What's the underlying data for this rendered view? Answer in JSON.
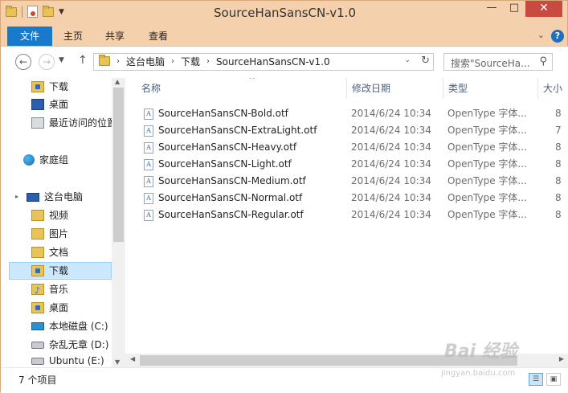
{
  "window": {
    "title": "SourceHanSansCN-v1.0",
    "minimize": "—",
    "maximize": "□",
    "close": "✕"
  },
  "ribbon": {
    "tabs": [
      "文件",
      "主页",
      "共享",
      "查看"
    ],
    "collapse": "⌄",
    "help": "?"
  },
  "nav_bar": {
    "back": "←",
    "forward": "→",
    "up": "↑",
    "breadcrumbs": [
      "这台电脑",
      "下载",
      "SourceHanSansCN-v1.0"
    ],
    "breadcrumb_sep": "›",
    "search_placeholder": "搜索\"SourceHa...",
    "search_icon": "search-icon",
    "refresh_icon": "refresh-icon"
  },
  "sidebar": {
    "items": [
      {
        "label": "下载",
        "icon": "download-folder-icon"
      },
      {
        "label": "桌面",
        "icon": "desktop-icon"
      },
      {
        "label": "最近访问的位置",
        "icon": "recent-places-icon"
      },
      {
        "label": "家庭组",
        "icon": "homegroup-icon"
      },
      {
        "label": "这台电脑",
        "icon": "computer-icon"
      },
      {
        "label": "视频",
        "icon": "videos-folder-icon"
      },
      {
        "label": "图片",
        "icon": "pictures-folder-icon"
      },
      {
        "label": "文档",
        "icon": "documents-folder-icon"
      },
      {
        "label": "下载",
        "icon": "download-folder-icon",
        "selected": true
      },
      {
        "label": "音乐",
        "icon": "music-folder-icon"
      },
      {
        "label": "桌面",
        "icon": "desktop-folder-icon"
      },
      {
        "label": "本地磁盘 (C:)",
        "icon": "windows-drive-icon"
      },
      {
        "label": "杂乱无章 (D:)",
        "icon": "drive-icon"
      },
      {
        "label": "Ubuntu (E:)",
        "icon": "drive-icon"
      }
    ]
  },
  "file_list": {
    "columns": [
      "名称",
      "修改日期",
      "类型",
      "大小"
    ],
    "rows": [
      {
        "name": "SourceHanSansCN-Bold.otf",
        "date": "2014/6/24 10:34",
        "type": "OpenType 字体...",
        "size": "8"
      },
      {
        "name": "SourceHanSansCN-ExtraLight.otf",
        "date": "2014/6/24 10:34",
        "type": "OpenType 字体...",
        "size": "7"
      },
      {
        "name": "SourceHanSansCN-Heavy.otf",
        "date": "2014/6/24 10:34",
        "type": "OpenType 字体...",
        "size": "8"
      },
      {
        "name": "SourceHanSansCN-Light.otf",
        "date": "2014/6/24 10:34",
        "type": "OpenType 字体...",
        "size": "8"
      },
      {
        "name": "SourceHanSansCN-Medium.otf",
        "date": "2014/6/24 10:34",
        "type": "OpenType 字体...",
        "size": "8"
      },
      {
        "name": "SourceHanSansCN-Normal.otf",
        "date": "2014/6/24 10:34",
        "type": "OpenType 字体...",
        "size": "8"
      },
      {
        "name": "SourceHanSansCN-Regular.otf",
        "date": "2014/6/24 10:34",
        "type": "OpenType 字体...",
        "size": "8"
      }
    ]
  },
  "status": {
    "item_count": "7 个项目"
  },
  "watermark": {
    "text": "Bai 经验",
    "sub": "jingyan.baidu.com"
  },
  "colors": {
    "accent": "#1979ca",
    "close": "#c74b40",
    "selection": "#cce8ff"
  }
}
